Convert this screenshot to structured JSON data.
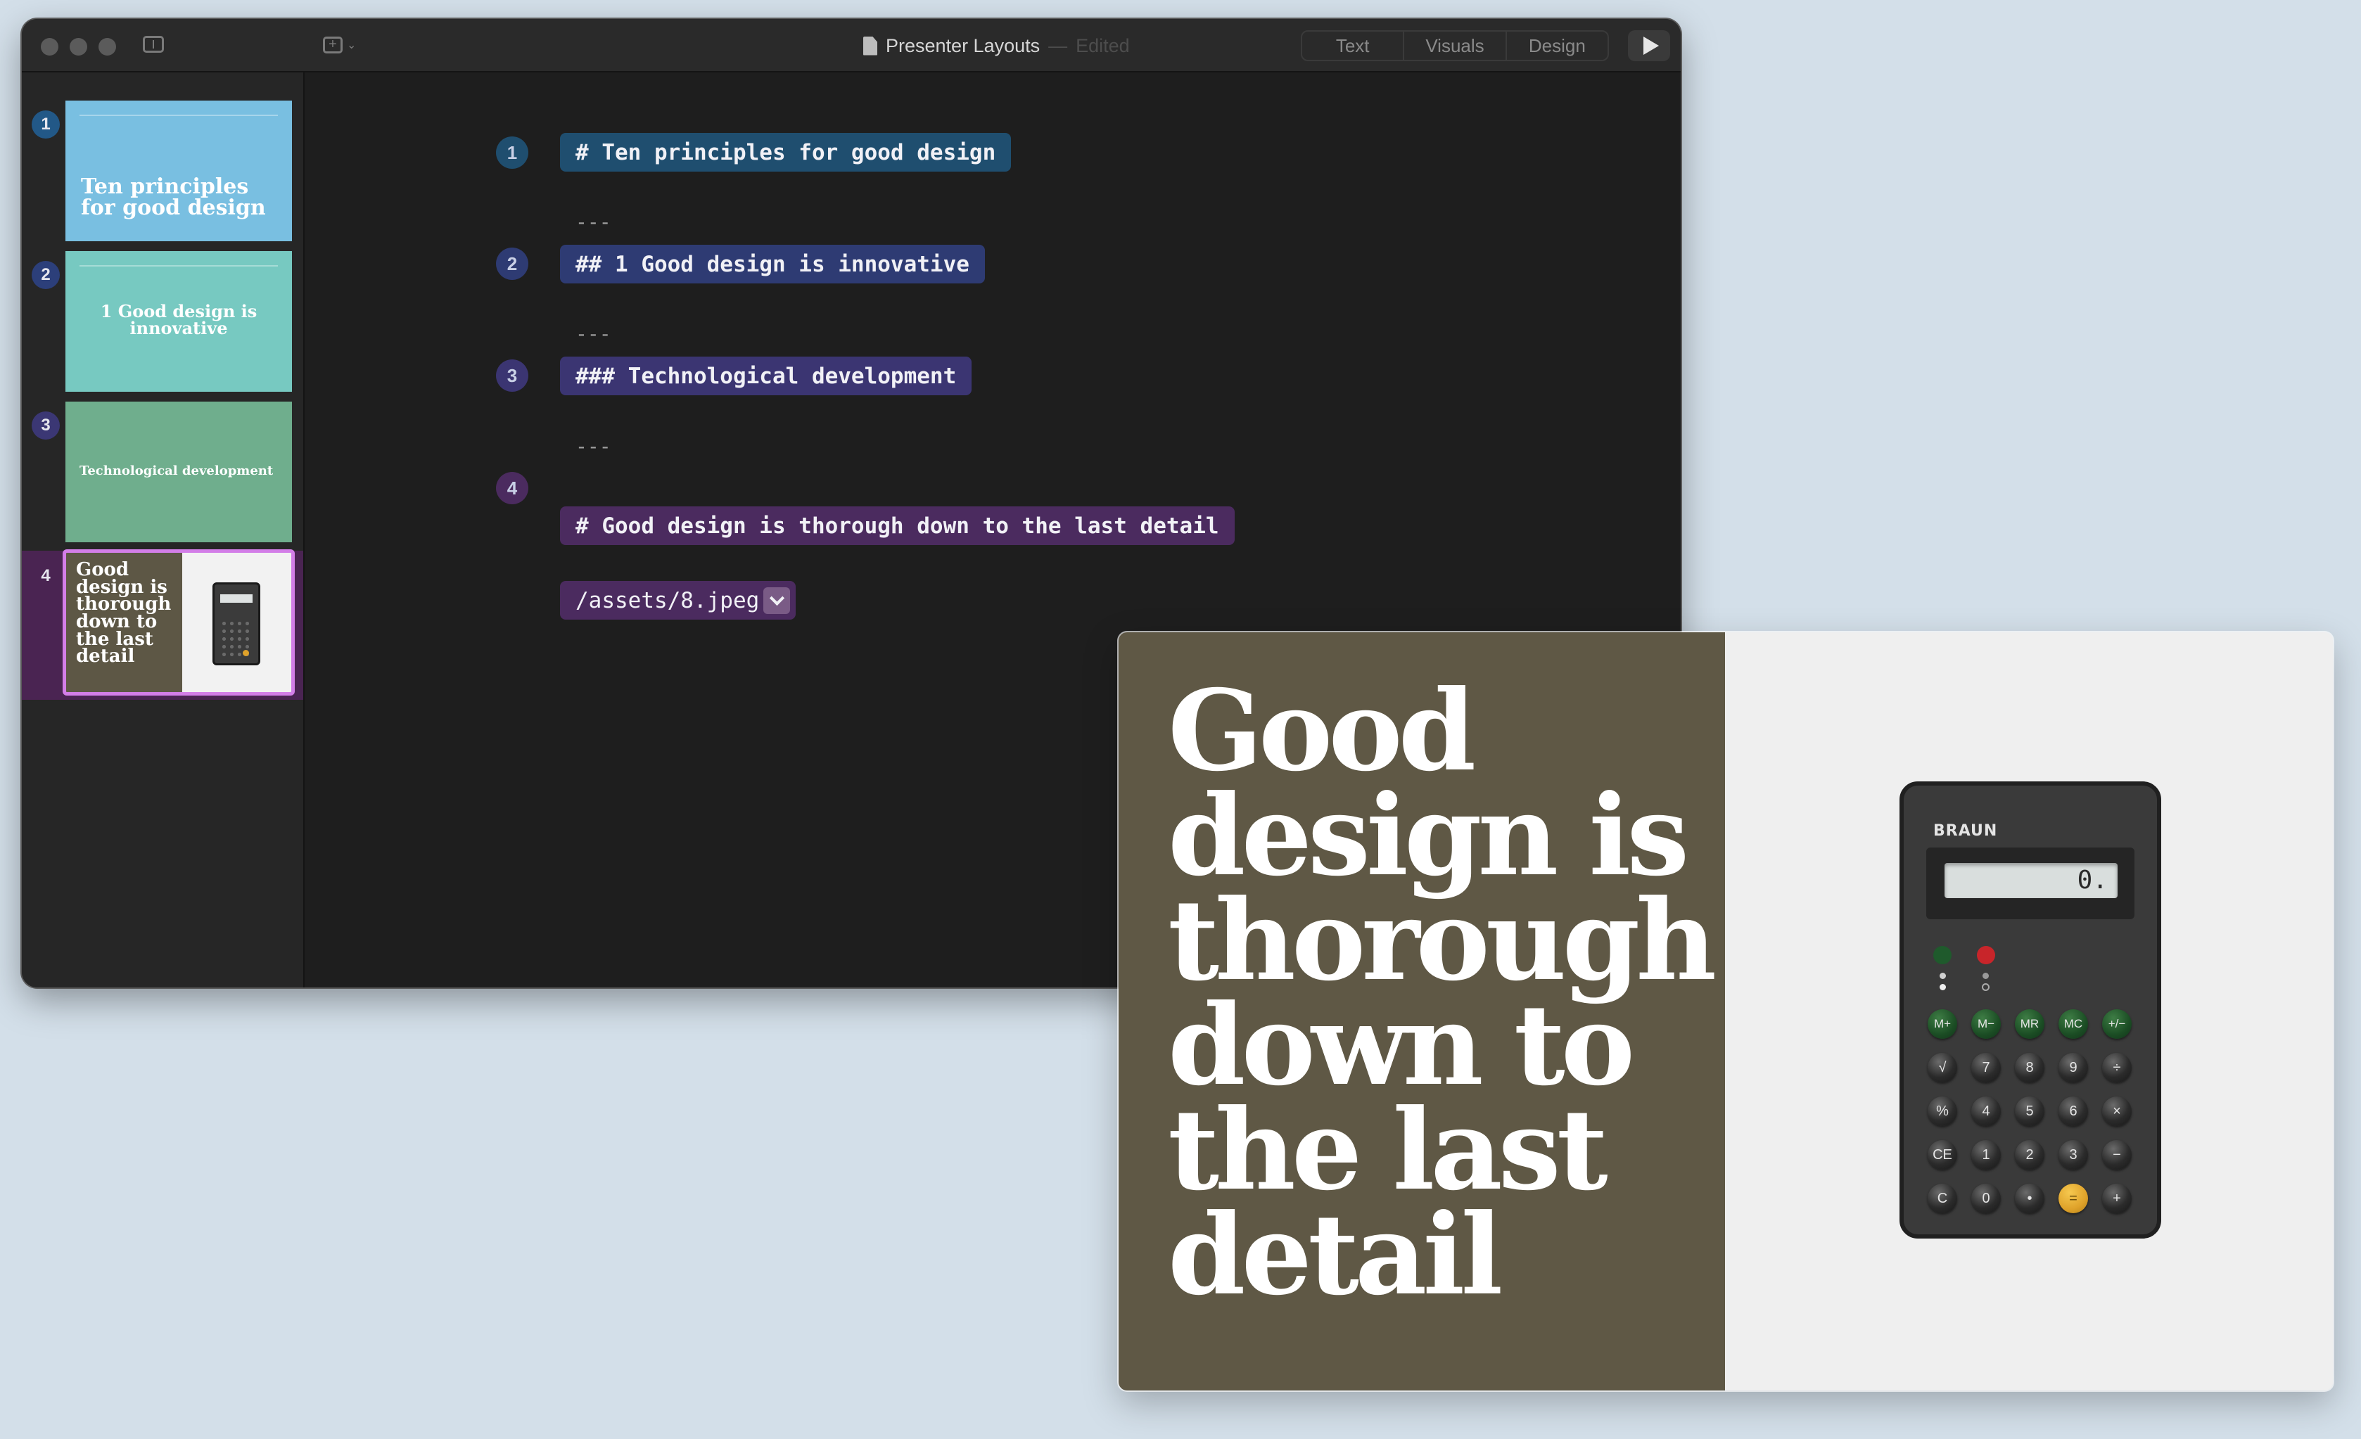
{
  "window": {
    "doc_title": "Presenter Layouts",
    "doc_separator": "—",
    "doc_status": "Edited",
    "segments": [
      "Text",
      "Visuals",
      "Design"
    ]
  },
  "slides": [
    {
      "number": "1",
      "title": "Ten principles for good design",
      "bg": "#79bfe1",
      "num_bg": "#225887"
    },
    {
      "number": "2",
      "title": "1 Good design is innovative",
      "bg": "#77c9c1",
      "num_bg": "#2c3f7a"
    },
    {
      "number": "3",
      "title": "Technological development",
      "bg": "#6fae8d",
      "num_bg": "#3b3774"
    },
    {
      "number": "4",
      "title": "Good design is thorough down to the last detail",
      "bg": "#5d5745",
      "num_bg": "#4a2452"
    }
  ],
  "editor": {
    "lines": [
      {
        "number": "1",
        "text": "# Ten principles for good design",
        "color": "#1f4e6f",
        "num_bg": "#1f4e6f"
      },
      {
        "number": "2",
        "text": "## 1 Good design is innovative",
        "color": "#2e3b73",
        "num_bg": "#2e3b73"
      },
      {
        "number": "3",
        "text": "### Technological development",
        "color": "#3b3572",
        "num_bg": "#3b3572"
      },
      {
        "number": "4",
        "text": "# Good design is thorough down to the last detail",
        "color": "#4b2b5f",
        "num_bg": "#4b2b5f"
      }
    ],
    "separator": "---",
    "asset": "/assets/8.jpeg"
  },
  "preview": {
    "title": "Good design is thorough down to the last detail",
    "calculator": {
      "brand": "BRAUN",
      "display": "0.",
      "keys": [
        [
          "M+",
          "M−",
          "MR",
          "MC",
          "+/−"
        ],
        [
          "√",
          "7",
          "8",
          "9",
          "÷"
        ],
        [
          "%",
          "4",
          "5",
          "6",
          "×"
        ],
        [
          "CE",
          "1",
          "2",
          "3",
          "−"
        ],
        [
          "C",
          "0",
          "•",
          "=",
          "+"
        ]
      ]
    }
  }
}
